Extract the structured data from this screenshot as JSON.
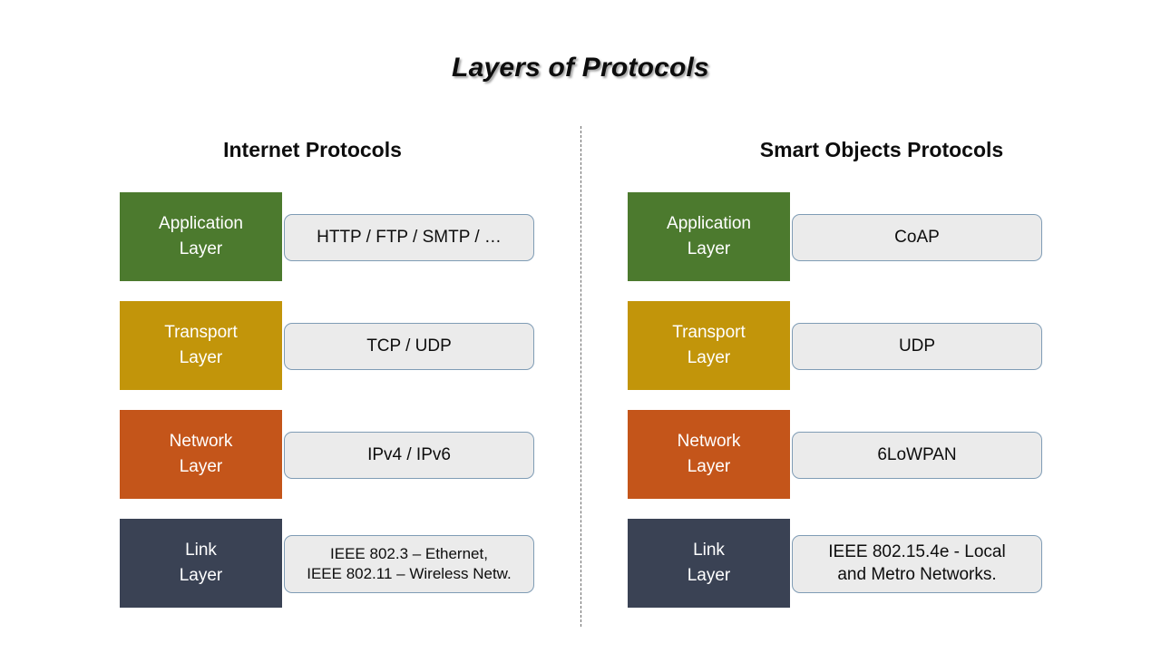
{
  "slide": {
    "title": "Layers of Protocols",
    "background": "#FFFFFF",
    "divider": "dashed-vertical-line"
  },
  "colors": {
    "application": "#4C7A2E",
    "transport": "#C2950A",
    "network": "#C4551A",
    "link": "#3A4254",
    "protocol_box_fill": "#EBEBEB",
    "protocol_box_border": "#7F9CB5",
    "text_on_layer": "#FFFFFF",
    "text_dark": "#0D0D0D"
  },
  "columns": [
    {
      "heading": "Internet Protocols",
      "rows": [
        {
          "layer_line1": "Application",
          "layer_line2": "Layer",
          "color_key": "application",
          "protocol": "HTTP / FTP /  SMTP / …",
          "protocol_line2": ""
        },
        {
          "layer_line1": "Transport",
          "layer_line2": "Layer",
          "color_key": "transport",
          "protocol": "TCP / UDP",
          "protocol_line2": ""
        },
        {
          "layer_line1": "Network",
          "layer_line2": "Layer",
          "color_key": "network",
          "protocol": "IPv4 / IPv6",
          "protocol_line2": ""
        },
        {
          "layer_line1": "Link",
          "layer_line2": "Layer",
          "color_key": "link",
          "protocol": "IEEE  802.3 – Ethernet,",
          "protocol_line2": "IEEE  802.11 – Wireless  Netw."
        }
      ]
    },
    {
      "heading": "Smart Objects Protocols",
      "rows": [
        {
          "layer_line1": "Application",
          "layer_line2": "Layer",
          "color_key": "application",
          "protocol": "CoAP",
          "protocol_line2": ""
        },
        {
          "layer_line1": "Transport",
          "layer_line2": "Layer",
          "color_key": "transport",
          "protocol": "UDP",
          "protocol_line2": ""
        },
        {
          "layer_line1": "Network",
          "layer_line2": "Layer",
          "color_key": "network",
          "protocol": "6LoWPAN",
          "protocol_line2": ""
        },
        {
          "layer_line1": "Link",
          "layer_line2": "Layer",
          "color_key": "link",
          "protocol": "IEEE 802.15.4e - Local",
          "protocol_line2": "and Metro Networks."
        }
      ]
    }
  ]
}
